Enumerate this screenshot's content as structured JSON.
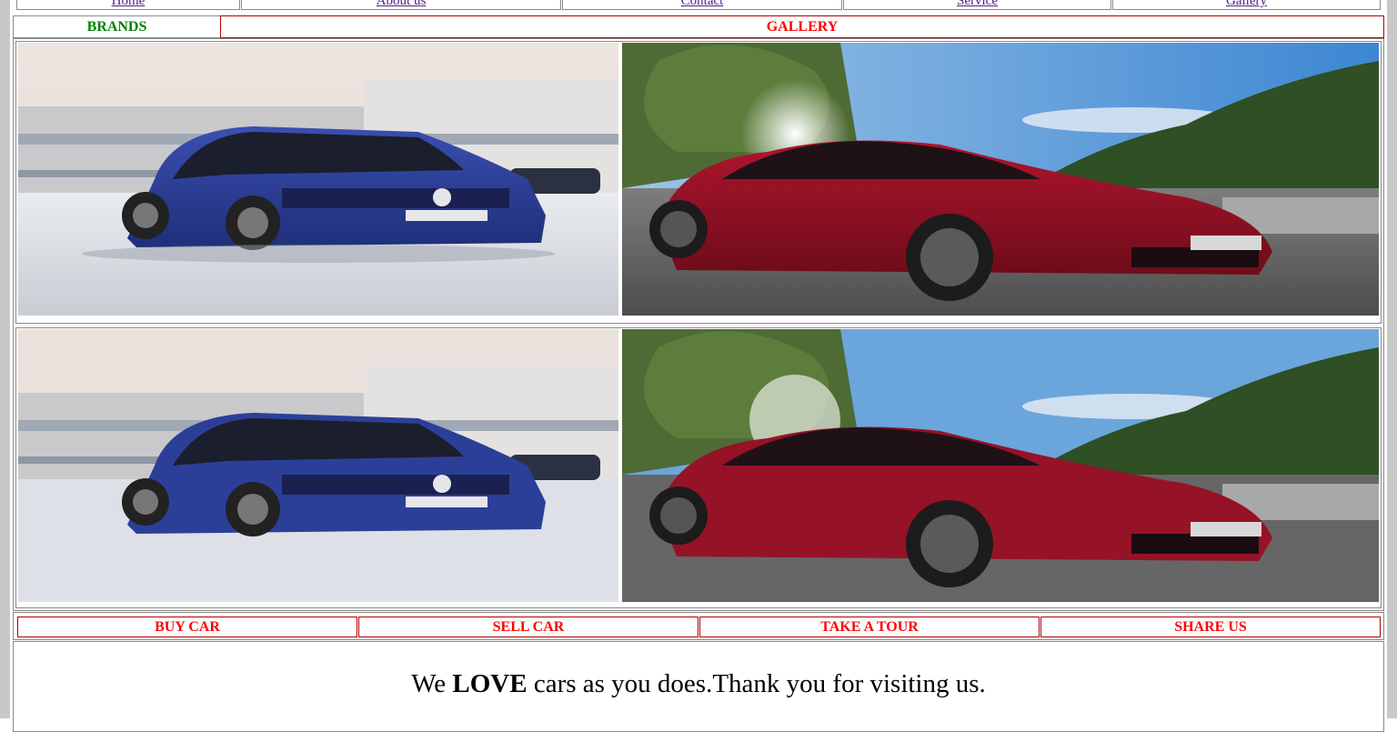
{
  "nav": {
    "items": [
      {
        "label": "Home"
      },
      {
        "label": "About us"
      },
      {
        "label": "Contact"
      },
      {
        "label": "Service"
      },
      {
        "label": "Gallery"
      }
    ]
  },
  "header": {
    "brands_label": "BRANDS",
    "gallery_label": "GALLERY",
    "brands_color": "#008000",
    "gallery_color": "#ff0000"
  },
  "gallery": {
    "images": [
      {
        "subject": "blue-volkswagen-hatchback-photo"
      },
      {
        "subject": "red-toyota-coupe-photo"
      },
      {
        "subject": "blue-volkswagen-hatchback-photo"
      },
      {
        "subject": "red-toyota-coupe-photo"
      }
    ]
  },
  "actions": {
    "buy": "BUY CAR",
    "sell": "SELL CAR",
    "tour": "TAKE A TOUR",
    "share": "SHARE US",
    "color": "#ff0000"
  },
  "footer": {
    "prefix": "We ",
    "emphasis": "LOVE",
    "suffix": " cars as you does.Thank you for visiting us."
  },
  "colors": {
    "frame": "#c8c8c8",
    "border_red": "#b00000",
    "link": "#551a8b"
  }
}
